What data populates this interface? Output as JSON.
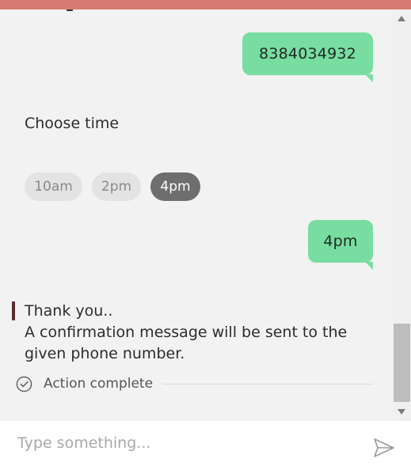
{
  "messages": {
    "user_phone": "8384034932",
    "choose_prompt": "Choose time",
    "user_time": "4pm",
    "thanks_line1": "Thank you..",
    "thanks_line2": "A confirmation message will be sent to the",
    "thanks_line3": "given phone number."
  },
  "time_options": [
    "10am",
    "2pm",
    "4pm"
  ],
  "selected_time": "4pm",
  "action": {
    "label": "Action complete"
  },
  "composer": {
    "placeholder": "Type something..."
  },
  "icons": {
    "check": "check-circle-icon",
    "send": "send-icon",
    "scroll_up": "chevron-up-icon",
    "scroll_down": "chevron-down-icon"
  },
  "colors": {
    "header_accent": "#d97a72",
    "user_bubble": "#78dda0",
    "chip_selected": "#6e6e6e",
    "chip_default": "#e3e3e3",
    "quote_bar": "#5a2e2e"
  }
}
